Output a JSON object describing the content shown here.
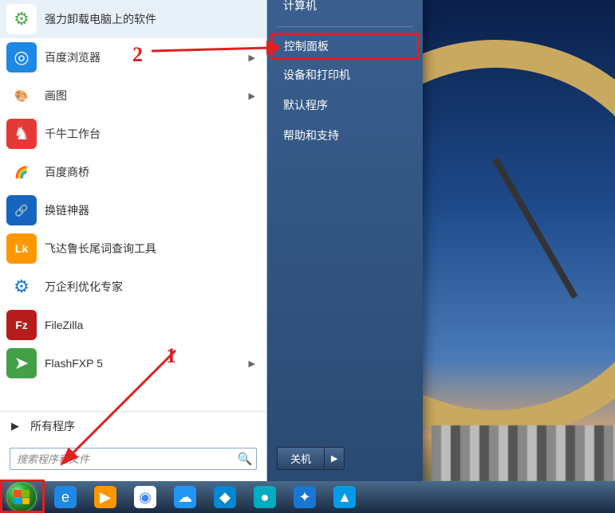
{
  "programs": [
    {
      "label": "强力卸载电脑上的软件",
      "icon_bg": "#fff",
      "icon_glyph": "⚙",
      "icon_color": "#4caf50"
    },
    {
      "label": "百度浏览器",
      "icon_bg": "#1e88e5",
      "icon_glyph": "◎",
      "has_submenu": true
    },
    {
      "label": "画图",
      "icon_bg": "#fff",
      "icon_glyph": "🎨",
      "has_submenu": true
    },
    {
      "label": "千牛工作台",
      "icon_bg": "#e53935",
      "icon_glyph": "♞"
    },
    {
      "label": "百度商桥",
      "icon_bg": "#fff",
      "icon_glyph": "🌈"
    },
    {
      "label": "换链神器",
      "icon_bg": "#1565c0",
      "icon_glyph": "🔗"
    },
    {
      "label": "飞达鲁长尾词查询工具",
      "icon_bg": "#ff9800",
      "icon_glyph": "Lk"
    },
    {
      "label": "万企利优化专家",
      "icon_bg": "#fff",
      "icon_glyph": "⚙",
      "icon_color": "#1976d2"
    },
    {
      "label": "FileZilla",
      "icon_bg": "#b71c1c",
      "icon_glyph": "Fz"
    },
    {
      "label": "FlashFXP 5",
      "icon_bg": "#43a047",
      "icon_glyph": "➤",
      "has_submenu": true
    }
  ],
  "all_programs_label": "所有程序",
  "search_placeholder": "搜索程序和文件",
  "right_menu": [
    {
      "label": "计算机",
      "cut": true
    },
    {
      "label": "控制面板",
      "highlighted": true
    },
    {
      "label": "设备和打印机"
    },
    {
      "label": "默认程序"
    },
    {
      "label": "帮助和支持"
    }
  ],
  "shutdown_label": "关机",
  "annotations": {
    "one": "1",
    "two": "2"
  },
  "taskbar_icons": [
    {
      "name": "ie",
      "bg": "#1e88e5",
      "glyph": "e"
    },
    {
      "name": "wmp",
      "bg": "#ff9800",
      "glyph": "▶"
    },
    {
      "name": "chrome",
      "bg": "#fff",
      "glyph": "◉",
      "color": "#4285f4"
    },
    {
      "name": "app1",
      "bg": "#2196f3",
      "glyph": "☁"
    },
    {
      "name": "app2",
      "bg": "#0288d1",
      "glyph": "◆"
    },
    {
      "name": "app3",
      "bg": "#00acc1",
      "glyph": "●"
    },
    {
      "name": "app4",
      "bg": "#1976d2",
      "glyph": "✦"
    },
    {
      "name": "app5",
      "bg": "#039be5",
      "glyph": "▲"
    }
  ]
}
